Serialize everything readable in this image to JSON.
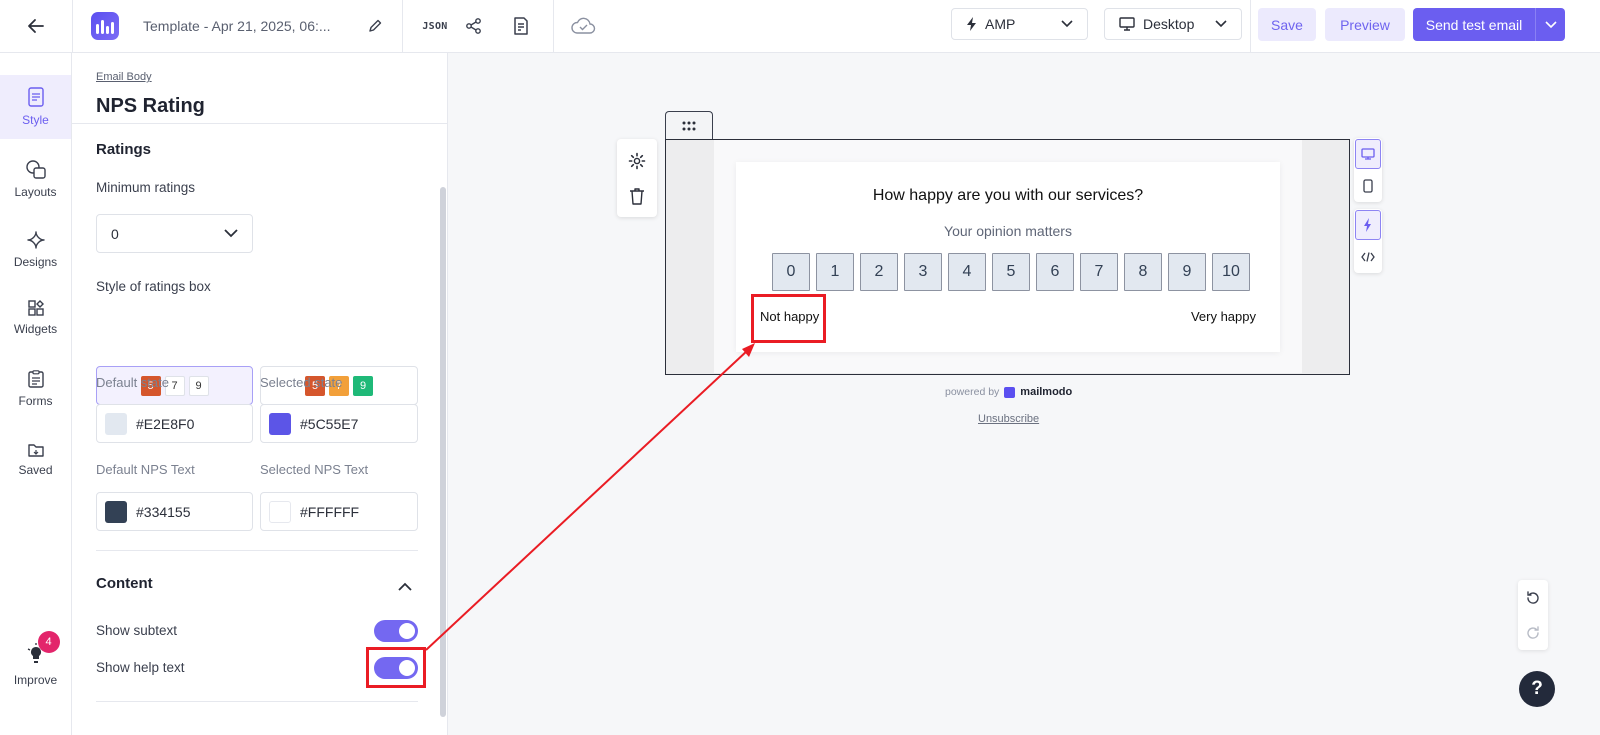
{
  "app": {
    "template_title": "Template - Apr 21, 2025, 06:...",
    "json_label": "JSON",
    "mode_select": "AMP",
    "device_select": "Desktop",
    "save_label": "Save",
    "preview_label": "Preview",
    "send_label": "Send test email"
  },
  "rail": {
    "items": [
      {
        "label": "Style",
        "icon": "style-icon"
      },
      {
        "label": "Layouts",
        "icon": "layouts-icon"
      },
      {
        "label": "Designs",
        "icon": "sparkle-icon"
      },
      {
        "label": "Widgets",
        "icon": "widgets-icon"
      },
      {
        "label": "Forms",
        "icon": "clipboard-icon"
      },
      {
        "label": "Saved",
        "icon": "folder-icon"
      }
    ],
    "improve_label": "Improve",
    "improve_badge": "4"
  },
  "panel": {
    "breadcrumb": "Email Body",
    "title": "NPS Rating",
    "ratings_heading": "Ratings",
    "min_ratings_label": "Minimum ratings",
    "min_ratings_value": "0",
    "style_label": "Style of ratings box",
    "style_option_1": [
      "5",
      "7",
      "9"
    ],
    "style_option_2": [
      "5",
      "7",
      "9"
    ],
    "default_state_label": "Default state",
    "default_state_value": "#E2E8F0",
    "selected_state_label": "Selected state",
    "selected_state_value": "#5C55E7",
    "default_text_label": "Default NPS Text",
    "default_text_value": "#334155",
    "selected_text_label": "Selected NPS Text",
    "selected_text_value": "#FFFFFF",
    "content_heading": "Content",
    "show_subtext_label": "Show subtext",
    "show_subtext_on": true,
    "show_helptext_label": "Show help text",
    "show_helptext_on": true
  },
  "canvas": {
    "question": "How happy are you with our services?",
    "subtext": "Your opinion matters",
    "scale": [
      "0",
      "1",
      "2",
      "3",
      "4",
      "5",
      "6",
      "7",
      "8",
      "9",
      "10"
    ],
    "help_left": "Not happy",
    "help_right": "Very happy",
    "powered_by": "powered by",
    "brand": "mailmodo",
    "unsubscribe": "Unsubscribe",
    "help_fab": "?"
  },
  "colors": {
    "accent": "#6B5EF0",
    "annotation": "#EA1C24",
    "default_state": "#E2E8F0",
    "selected_state": "#5C55E7",
    "default_text": "#334155",
    "selected_text": "#FFFFFF"
  }
}
